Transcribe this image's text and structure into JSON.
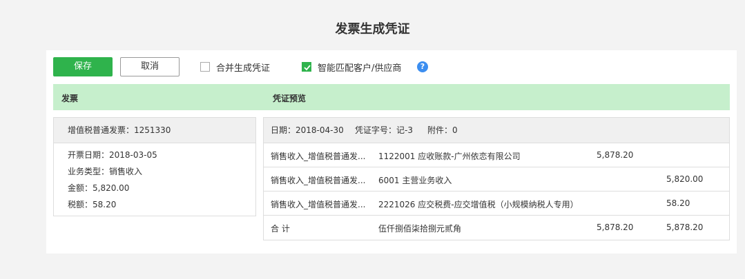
{
  "page_title": "发票生成凭证",
  "toolbar": {
    "save_label": "保存",
    "cancel_label": "取消",
    "merge_label": "合并生成凭证",
    "merge_checked": false,
    "smart_match_label": "智能匹配客户/供应商",
    "smart_match_checked": true,
    "help_icon": "?"
  },
  "header": {
    "invoice_label": "发票",
    "voucher_label": "凭证预览"
  },
  "invoice": {
    "title": "增值税普通发票：1251330",
    "lines": [
      "开票日期：2018-03-05",
      "业务类型：销售收入",
      "金额：5,820.00",
      "税额：58.20"
    ]
  },
  "voucher": {
    "date": "日期：2018-04-30",
    "number": "凭证字号：记-3",
    "attachments": "附件：0",
    "rows": [
      {
        "summary": "销售收入_增值税普通发...",
        "account": "1122001 应收账款-广州依恋有限公司",
        "debit": "5,878.20",
        "credit": ""
      },
      {
        "summary": "销售收入_增值税普通发...",
        "account": "6001 主营业务收入",
        "debit": "",
        "credit": "5,820.00"
      },
      {
        "summary": "销售收入_增值税普通发...",
        "account": "2221026 应交税费-应交增值税（小规模纳税人专用）",
        "debit": "",
        "credit": "58.20"
      },
      {
        "summary": "合  计",
        "account": "伍仟捌佰柒拾捌元贰角",
        "debit": "5,878.20",
        "credit": "5,878.20"
      }
    ]
  },
  "colors": {
    "accent": "#2fb34c",
    "header_green": "#c6efcc",
    "help_blue": "#3c8ef0"
  }
}
